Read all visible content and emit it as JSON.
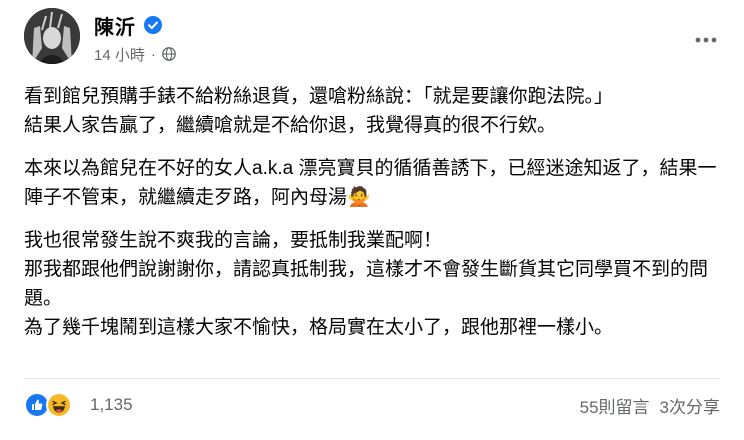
{
  "header": {
    "author": "陳沂",
    "time": "14 小時",
    "separator": "·"
  },
  "post": {
    "paragraphs": [
      "看到館兒預購手錶不給粉絲退貨，還嗆粉絲說：「就是要讓你跑法院。」\n結果人家告贏了，繼續嗆就是不給你退，我覺得真的很不行欸。",
      "本來以為館兒在不好的女人a.k.a 漂亮寶貝的循循善誘下，已經迷途知返了，結果一陣子不管束，就繼續走歹路，阿內母湯🙅",
      "我也很常發生說不爽我的言論，要抵制我業配啊！\n那我都跟他們說謝謝你，請認真抵制我，這樣才不會發生斷貨其它同學買不到的問題。\n為了幾千塊鬧到這樣大家不愉快，格局實在太小了，跟他那裡一樣小。"
    ]
  },
  "footer": {
    "reaction_count": "1,135",
    "comments": "55則留言",
    "shares": "3次分享"
  },
  "colors": {
    "verified_blue": "#1877f2",
    "like_blue": "#1877f2",
    "haha_yellow": "#f7b928",
    "secondary_text": "#65676b"
  },
  "icons": {
    "verified": "verified-badge-icon",
    "audience": "globe-icon",
    "more": "more-options-icon",
    "like": "like-reaction-icon",
    "haha": "haha-reaction-icon"
  }
}
